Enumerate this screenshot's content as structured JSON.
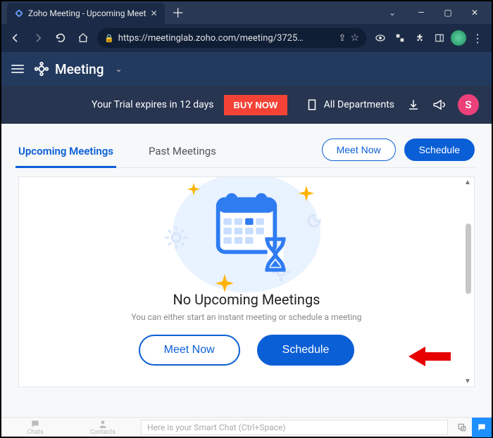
{
  "window": {
    "tab_title": "Zoho Meeting - Upcoming Meet"
  },
  "url": {
    "text": "https://meetinglab.zoho.com/meeting/3725…"
  },
  "app": {
    "brand": "Meeting"
  },
  "banner": {
    "trial_text": "Your Trial expires in 12 days",
    "buy_now": "BUY NOW",
    "departments": "All Departments",
    "avatar_initial": "S"
  },
  "tabs": {
    "upcoming": "Upcoming Meetings",
    "past": "Past Meetings"
  },
  "actions": {
    "meet_now": "Meet Now",
    "schedule": "Schedule"
  },
  "empty": {
    "title": "No Upcoming Meetings",
    "subtitle": "You can either start an instant meeting or schedule a meeting",
    "meet_now": "Meet Now",
    "schedule": "Schedule"
  },
  "footer": {
    "chats": "Chats",
    "contacts": "Contacts",
    "smart_chat_placeholder": "Here is your Smart Chat (Ctrl+Space)"
  }
}
